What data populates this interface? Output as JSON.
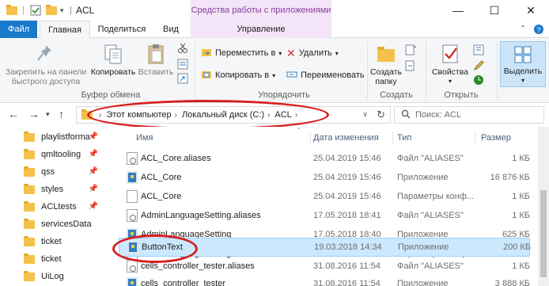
{
  "window": {
    "title": "ACL",
    "context_tab_group": "Средства работы с приложениями",
    "minimize": "—",
    "maximize": "☐",
    "close": "✕"
  },
  "ribbon_tabs": {
    "file": "Файл",
    "home": "Главная",
    "share": "Поделиться",
    "view": "Вид",
    "manage": "Управление"
  },
  "ribbon": {
    "clipboard": {
      "pin_label": "Закрепить на панели быстрого доступа",
      "copy_label": "Копировать",
      "paste_label": "Вставить",
      "group_label": "Буфер обмена"
    },
    "organize": {
      "move_label": "Переместить в",
      "copy_to_label": "Копировать в",
      "delete_label": "Удалить",
      "rename_label": "Переименовать",
      "group_label": "Упорядочить"
    },
    "create": {
      "new_folder_label": "Создать папку",
      "group_label": "Создать"
    },
    "open": {
      "properties_label": "Свойства",
      "group_label": "Открыть"
    },
    "select": {
      "select_label": "Выделить"
    }
  },
  "address": {
    "crumbs": [
      "Этот компьютер",
      "Локальный диск (C:)",
      "ACL"
    ],
    "search_placeholder": "Поиск: ACL"
  },
  "nav_pane": {
    "items": [
      {
        "label": "playlistforma",
        "pinned": true
      },
      {
        "label": "qmltooling",
        "pinned": true
      },
      {
        "label": "qss",
        "pinned": true
      },
      {
        "label": "styles",
        "pinned": true
      },
      {
        "label": "ACLtests",
        "pinned": true
      },
      {
        "label": "servicesData",
        "pinned": false
      },
      {
        "label": "ticket",
        "pinned": false
      },
      {
        "label": "ticket",
        "pinned": false
      },
      {
        "label": "UiLog",
        "pinned": false
      }
    ]
  },
  "columns": {
    "name": "Имя",
    "date": "Дата изменения",
    "type": "Тип",
    "size": "Размер"
  },
  "files": [
    {
      "name": "ACL_Core.aliases",
      "date": "25.04.2019 15:46",
      "type": "Файл \"ALIASES\"",
      "size": "1 КБ",
      "icon": "cfg"
    },
    {
      "name": "ACL_Core",
      "date": "25.04.2019 15:46",
      "type": "Приложение",
      "size": "16 876 КБ",
      "icon": "app"
    },
    {
      "name": "ACL_Core",
      "date": "25.04.2019 15:46",
      "type": "Параметры конф...",
      "size": "1 КБ",
      "icon": "doc"
    },
    {
      "name": "AdminLanguageSetting.aliases",
      "date": "17.05.2018 18:41",
      "type": "Файл \"ALIASES\"",
      "size": "1 КБ",
      "icon": "cfg"
    },
    {
      "name": "AdminLanguageSetting",
      "date": "17.05.2018 18:40",
      "type": "Приложение",
      "size": "625 КБ",
      "icon": "app"
    },
    {
      "name": "AdminLanguageSetting",
      "date": "17.05.2018 18:41",
      "type": "Параметры конф...",
      "size": "1 КБ",
      "icon": "doc"
    },
    {
      "name": "ButtonText",
      "date": "19.03.2018 14:34",
      "type": "Приложение",
      "size": "200 КБ",
      "icon": "app",
      "selected": true
    },
    {
      "name": "cells_controller_tester.aliases",
      "date": "31.08.2016 11:54",
      "type": "Файл \"ALIASES\"",
      "size": "1 КБ",
      "icon": "cfg"
    },
    {
      "name": "cells_controller_tester",
      "date": "31.08.2016 11:54",
      "type": "Приложение",
      "size": "3 888 КБ",
      "icon": "app"
    }
  ]
}
